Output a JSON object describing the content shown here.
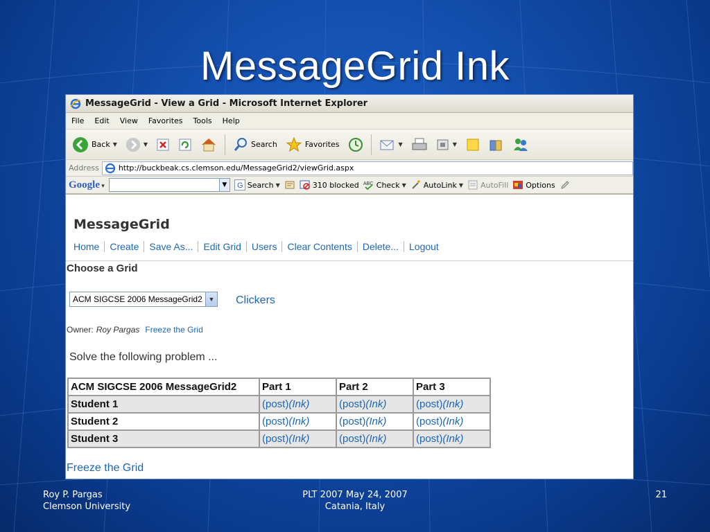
{
  "slide": {
    "title": "MessageGrid Ink",
    "footer_left_line1": "Roy P. Pargas",
    "footer_left_line2": "Clemson University",
    "footer_center_line1": "PLT 2007  May 24, 2007",
    "footer_center_line2": "Catania, Italy",
    "slide_number": "21"
  },
  "browser": {
    "window_title": "MessageGrid - View a Grid - Microsoft Internet Explorer",
    "menu": [
      "File",
      "Edit",
      "View",
      "Favorites",
      "Tools",
      "Help"
    ],
    "toolbar": {
      "back_label": "Back",
      "search_label": "Search",
      "favorites_label": "Favorites"
    },
    "address": {
      "label": "Address",
      "url": "http://buckbeak.cs.clemson.edu/MessageGrid2/viewGrid.aspx"
    },
    "google_toolbar": {
      "logo": "Google",
      "search_label": "Search",
      "blocked_label": "310 blocked",
      "check_label": "Check",
      "autolink_label": "AutoLink",
      "autofill_label": "AutoFill",
      "options_label": "Options"
    }
  },
  "page": {
    "site_title": "MessageGrid",
    "nav": [
      "Home",
      "Create",
      "Save As...",
      "Edit Grid",
      "Users",
      "Clear Contents",
      "Delete...",
      "Logout"
    ],
    "choose_heading": "Choose a Grid",
    "grid_select_value": "ACM SIGCSE 2006 MessageGrid2",
    "clickers_link": "Clickers",
    "owner_label": "Owner:",
    "owner_name": "Roy Pargas",
    "freeze_link_small": "Freeze the Grid",
    "problem_text": "Solve the following problem ...",
    "table": {
      "headers": [
        "ACM SIGCSE 2006 MessageGrid2",
        "Part 1",
        "Part 2",
        "Part 3"
      ],
      "rows": [
        {
          "name": "Student 1",
          "cells": [
            {
              "post": "(post)",
              "ink": "(Ink)"
            },
            {
              "post": "(post)",
              "ink": "(Ink)"
            },
            {
              "post": "(post)",
              "ink": "(Ink)"
            }
          ]
        },
        {
          "name": "Student 2",
          "cells": [
            {
              "post": "(post)",
              "ink": "(Ink)"
            },
            {
              "post": "(post)",
              "ink": "(Ink)"
            },
            {
              "post": "(post)",
              "ink": "(Ink)"
            }
          ]
        },
        {
          "name": "Student 3",
          "cells": [
            {
              "post": "(post)",
              "ink": "(Ink)"
            },
            {
              "post": "(post)",
              "ink": "(Ink)"
            },
            {
              "post": "(post)",
              "ink": "(Ink)"
            }
          ]
        }
      ]
    },
    "freeze_link_bottom": "Freeze the Grid"
  },
  "colors": {
    "link": "#1c66b6",
    "slide_bg": "#1450b0"
  }
}
